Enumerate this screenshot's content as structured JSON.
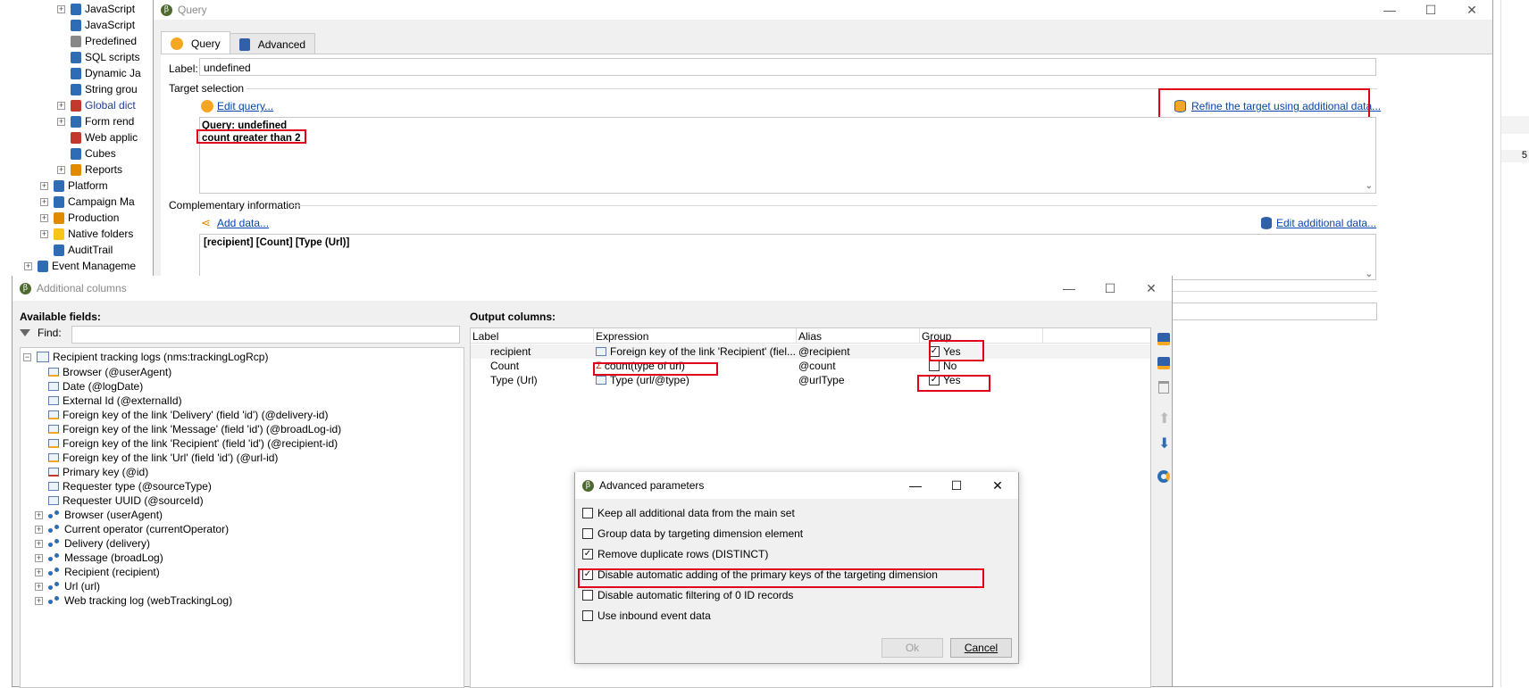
{
  "explorer": {
    "items": [
      {
        "label": "JavaScript",
        "expandable": true,
        "color": "#000"
      },
      {
        "label": "JavaScript",
        "expandable": false,
        "color": "#000"
      },
      {
        "label": "Predefined",
        "expandable": false,
        "color": "#000"
      },
      {
        "label": "SQL scripts",
        "expandable": false,
        "color": "#000"
      },
      {
        "label": "Dynamic Ja",
        "expandable": false,
        "color": "#000"
      },
      {
        "label": "String grou",
        "expandable": false,
        "color": "#000"
      },
      {
        "label": "Global dict",
        "expandable": true,
        "color": "#1f3f9a"
      },
      {
        "label": "Form rend",
        "expandable": true,
        "color": "#000"
      },
      {
        "label": "Web applic",
        "expandable": false,
        "color": "#000"
      },
      {
        "label": "Cubes",
        "expandable": false,
        "color": "#000"
      },
      {
        "label": "Reports",
        "expandable": true,
        "color": "#000"
      },
      {
        "label": "Platform",
        "expandable": true,
        "color": "#000"
      },
      {
        "label": "Campaign Ma",
        "expandable": true,
        "color": "#000"
      },
      {
        "label": "Production",
        "expandable": true,
        "color": "#000"
      },
      {
        "label": "Native folders",
        "expandable": true,
        "color": "#000"
      },
      {
        "label": "AuditTrail",
        "expandable": false,
        "color": "#000"
      },
      {
        "label": "Event Manageme",
        "expandable": true,
        "color": "#000"
      }
    ],
    "right_number": "5"
  },
  "query_window": {
    "title": "Query",
    "tabs": [
      {
        "label": "Query"
      },
      {
        "label": "Advanced"
      }
    ],
    "label_caption": "Label:",
    "label_value": "undefined",
    "target_selection": "Target selection",
    "edit_query": "Edit query...",
    "refine_link": "Refine the target using additional data...",
    "query_line1": "Query: undefined",
    "query_line2": "count greater than 2",
    "complementary": "Complementary information",
    "add_data": "Add data...",
    "edit_additional": "Edit additional data...",
    "columns_summary": "[recipient]  [Count]  [Type (Url)]"
  },
  "additional_columns": {
    "title": "Additional columns",
    "available_fields": "Available fields:",
    "find_label": "Find:",
    "find_value": "",
    "root": "Recipient tracking logs (nms:trackingLogRcp)",
    "fields": [
      {
        "label": "Browser (@userAgent)",
        "kind": "field-fk"
      },
      {
        "label": "Date (@logDate)",
        "kind": "field"
      },
      {
        "label": "External Id (@externalId)",
        "kind": "field"
      },
      {
        "label": "Foreign key of the link 'Delivery' (field 'id') (@delivery-id)",
        "kind": "field-fk"
      },
      {
        "label": "Foreign key of the link 'Message' (field 'id') (@broadLog-id)",
        "kind": "field-fk"
      },
      {
        "label": "Foreign key of the link 'Recipient' (field 'id') (@recipient-id)",
        "kind": "field-fk"
      },
      {
        "label": "Foreign key of the link 'Url' (field 'id') (@url-id)",
        "kind": "field-fk"
      },
      {
        "label": "Primary key (@id)",
        "kind": "field-pk"
      },
      {
        "label": "Requester type (@sourceType)",
        "kind": "field"
      },
      {
        "label": "Requester UUID (@sourceId)",
        "kind": "field"
      },
      {
        "label": "Browser (userAgent)",
        "kind": "link"
      },
      {
        "label": "Current operator (currentOperator)",
        "kind": "link"
      },
      {
        "label": "Delivery (delivery)",
        "kind": "link"
      },
      {
        "label": "Message (broadLog)",
        "kind": "link"
      },
      {
        "label": "Recipient (recipient)",
        "kind": "link"
      },
      {
        "label": "Url (url)",
        "kind": "link"
      },
      {
        "label": "Web tracking log (webTrackingLog)",
        "kind": "link"
      }
    ],
    "output_columns": "Output columns:",
    "headers": {
      "label": "Label",
      "expression": "Expression",
      "alias": "Alias",
      "group": "Group"
    },
    "rows": [
      {
        "label": "recipient",
        "expression": "Foreign key of the link 'Recipient' (fiel...",
        "alias": "@recipient",
        "group_checked": true,
        "group": "Yes"
      },
      {
        "label": "Count",
        "expression": "count(type of url)",
        "alias": "@count",
        "group_checked": false,
        "group": "No"
      },
      {
        "label": "Type (Url)",
        "expression": "Type (url/@type)",
        "alias": "@urlType",
        "group_checked": true,
        "group": "Yes"
      }
    ]
  },
  "advanced_parameters": {
    "title": "Advanced parameters",
    "options": [
      {
        "label": "Keep all additional data from the main set",
        "checked": false
      },
      {
        "label": "Group data by targeting dimension element",
        "checked": false
      },
      {
        "label": "Remove duplicate rows (DISTINCT)",
        "checked": true
      },
      {
        "label": "Disable automatic adding of the primary keys of the targeting dimension",
        "checked": true
      },
      {
        "label": "Disable automatic filtering of 0 ID records",
        "checked": false
      },
      {
        "label": "Use inbound event data",
        "checked": false
      }
    ],
    "ok": "Ok",
    "cancel": "Cancel"
  },
  "colors": {
    "highlight": "#e0001b",
    "link": "#0645ad",
    "accent": "#f5a623"
  }
}
